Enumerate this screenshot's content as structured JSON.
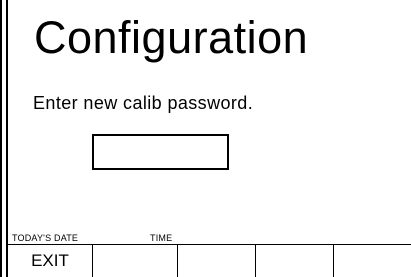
{
  "screen": {
    "title": "Configuration",
    "prompt": "Enter new calib password.",
    "password_value": ""
  },
  "status": {
    "date_label": "TODAY'S DATE",
    "time_label": "TIME"
  },
  "softkeys": [
    {
      "label": "EXIT"
    },
    {
      "label": ""
    },
    {
      "label": ""
    },
    {
      "label": ""
    },
    {
      "label": ""
    }
  ]
}
